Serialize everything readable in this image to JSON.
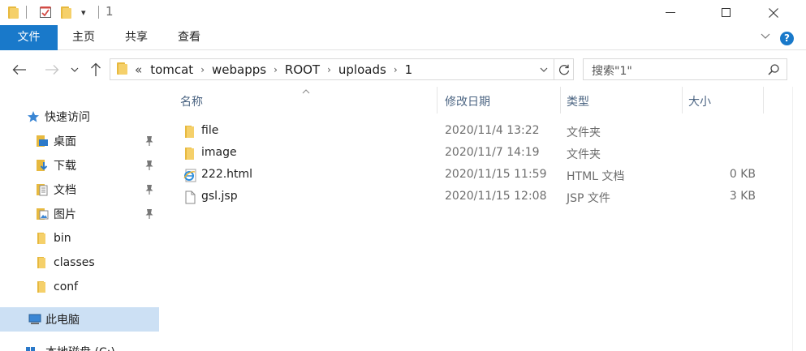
{
  "window": {
    "title": "1",
    "quick_access_dropdown_glyph": "▾"
  },
  "ribbon": {
    "tabs": [
      "文件",
      "主页",
      "共享",
      "查看"
    ],
    "help_label": "?"
  },
  "address": {
    "overflow_glyph": "«",
    "crumbs": [
      "tomcat",
      "webapps",
      "ROOT",
      "uploads",
      "1"
    ],
    "separator_glyph": "›"
  },
  "search": {
    "placeholder": "搜索\"1\""
  },
  "nav": {
    "quick_access_label": "快速访问",
    "items": [
      {
        "label": "桌面",
        "icon": "desktop-icon",
        "pinned": true
      },
      {
        "label": "下载",
        "icon": "download-icon",
        "pinned": true
      },
      {
        "label": "文档",
        "icon": "documents-icon",
        "pinned": true
      },
      {
        "label": "图片",
        "icon": "pictures-icon",
        "pinned": true
      },
      {
        "label": "bin",
        "icon": "folder-icon",
        "pinned": false
      },
      {
        "label": "classes",
        "icon": "folder-icon",
        "pinned": false
      },
      {
        "label": "conf",
        "icon": "folder-icon",
        "pinned": false
      }
    ],
    "this_pc_label": "此电脑",
    "local_disk_label": "本地磁盘 (C:)"
  },
  "columns": {
    "name": "名称",
    "date": "修改日期",
    "type": "类型",
    "size": "大小"
  },
  "files": [
    {
      "name": "file",
      "date": "2020/11/4 13:22",
      "type": "文件夹",
      "size": "",
      "icon": "folder-icon"
    },
    {
      "name": "image",
      "date": "2020/11/7 14:19",
      "type": "文件夹",
      "size": "",
      "icon": "folder-icon"
    },
    {
      "name": "222.html",
      "date": "2020/11/15 11:59",
      "type": "HTML 文档",
      "size": "0 KB",
      "icon": "ie-html-icon"
    },
    {
      "name": "gsl.jsp",
      "date": "2020/11/15 12:08",
      "type": "JSP 文件",
      "size": "3 KB",
      "icon": "blank-file-icon"
    }
  ],
  "colors": {
    "file_tab": "#1979ca",
    "selected_nav": "#cce0f4",
    "folder_yellow": "#f5d06a",
    "header_text": "#4b6482"
  }
}
